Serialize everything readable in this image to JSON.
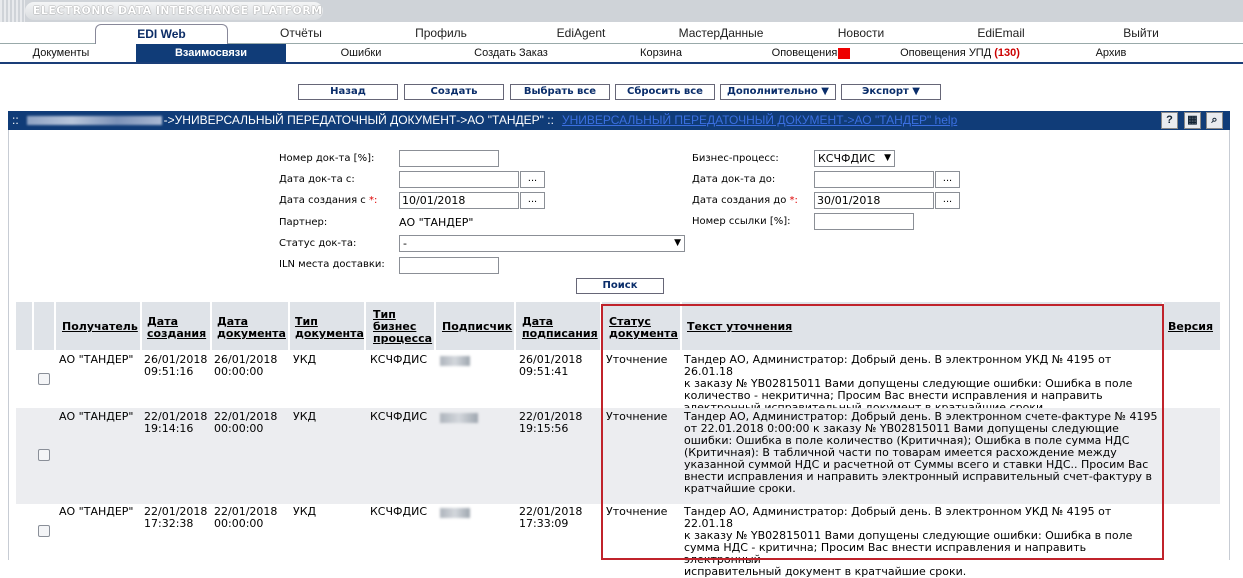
{
  "platform_title": "ELECTRONIC DATA INTERCHANGE PLATFORM",
  "main_nav": [
    "EDI Web",
    "Отчёты",
    "Профиль",
    "EdiAgent",
    "МастерДанные",
    "Новости",
    "EdiEmail",
    "Выйти"
  ],
  "sub_nav": {
    "documents": "Документы",
    "relations": "Взаимосвязи",
    "errors": "Ошибки",
    "create_order": "Создать Заказ",
    "cart": "Корзина",
    "notifications": "Оповещения",
    "notifications_upd": "Оповещения УПД",
    "notifications_upd_count": "(130)",
    "archive": "Архив"
  },
  "toolbar": {
    "back": "Назад",
    "create": "Создать",
    "select_all": "Выбрать все",
    "reset_all": "Сбросить все",
    "more": "Дополнительно ▼",
    "export": "Экспорт ▼"
  },
  "panel": {
    "prefix": "::",
    "title": "->УНИВЕРСАЛЬНЫЙ ПЕРЕДАТОЧНЫЙ ДОКУМЕНТ->АО \"ТАНДЕР\" ::",
    "link": "УНИВЕРСАЛЬНЫЙ ПЕРЕДАТОЧНЫЙ ДОКУМЕНТ->АО \"ТАНДЕР\" help"
  },
  "filters": {
    "doc_number_label": "Номер док-та [%]:",
    "doc_date_from_label": "Дата док-та с:",
    "created_from_label": "Дата создания с",
    "created_from_value": "10/01/2018",
    "partner_label": "Партнер:",
    "partner_value": "АО \"ТАНДЕР\"",
    "status_label": "Статус док-та:",
    "status_value": "-",
    "iln_label": "ILN места доставки:",
    "process_label": "Бизнес-процесс:",
    "process_value": "КСЧФДИС",
    "doc_date_to_label": "Дата док-та до:",
    "created_to_label": "Дата создания до",
    "created_to_value": "30/01/2018",
    "ref_number_label": "Номер ссылки [%]:",
    "star": "*:",
    "dots": "...",
    "search_button": "Поиск"
  },
  "table": {
    "headers": [
      "Получатель",
      "Дата создания",
      "Дата документа",
      "Тип документа",
      "Тип бизнес процесса",
      "Подписчик",
      "Дата подписания",
      "Статус документа",
      "Текст уточнения",
      "Версия"
    ],
    "rows": [
      {
        "recipient": "АО \"ТАНДЕР\"",
        "created": "26/01/2018\n09:51:16",
        "doc_date": "26/01/2018\n00:00:00",
        "doc_type": "УКД",
        "process": "КСЧФДИС",
        "signed": "26/01/2018\n09:51:41",
        "status": "Уточнение",
        "text": "Тандер АО, Администратор: Добрый день. В электронном УКД № 4195 от 26.01.18\nк заказу № YB02815011 Вами допущены следующие ошибки: Ошибка в поле\nколичество - некритична; Просим Вас внести исправления и направить\nэлектронный исправительный документ в кратчайшие сроки."
      },
      {
        "recipient": "АО \"ТАНДЕР\"",
        "created": "22/01/2018\n19:14:16",
        "doc_date": "22/01/2018\n00:00:00",
        "doc_type": "УКД",
        "process": "КСЧФДИС",
        "signed": "22/01/2018\n19:15:56",
        "status": "Уточнение",
        "text": "Тандер АО, Администратор: Добрый день. В электронном счете-фактуре № 4195\nот 22.01.2018 0:00:00 к заказу № YB02815011 Вами допущены следующие\nошибки: Ошибка в поле количество (Критичная); Ошибка в поле сумма НДС\n(Критичная): В табличной части по товарам имеется расхождение между\nуказанной суммой НДС и расчетной от Суммы всего и ставки НДС.. Просим Вас\nвнести исправления и направить электронный исправительный счет-фактуру в\nкратчайшие сроки."
      },
      {
        "recipient": "АО \"ТАНДЕР\"",
        "created": "22/01/2018\n17:32:38",
        "doc_date": "22/01/2018\n00:00:00",
        "doc_type": "УКД",
        "process": "КСЧФДИС",
        "signed": "22/01/2018\n17:33:09",
        "status": "Уточнение",
        "text": "Тандер АО, Администратор: Добрый день. В электронном УКД № 4195 от 22.01.18\nк заказу № YB02815011 Вами допущены следующие ошибки: Ошибка в поле\nсумма НДС - критична; Просим Вас внести исправления и направить электронный\nисправительный документ в кратчайшие сроки."
      }
    ]
  },
  "colors": {
    "brand": "#103c78",
    "highlight": "#c0232b"
  }
}
